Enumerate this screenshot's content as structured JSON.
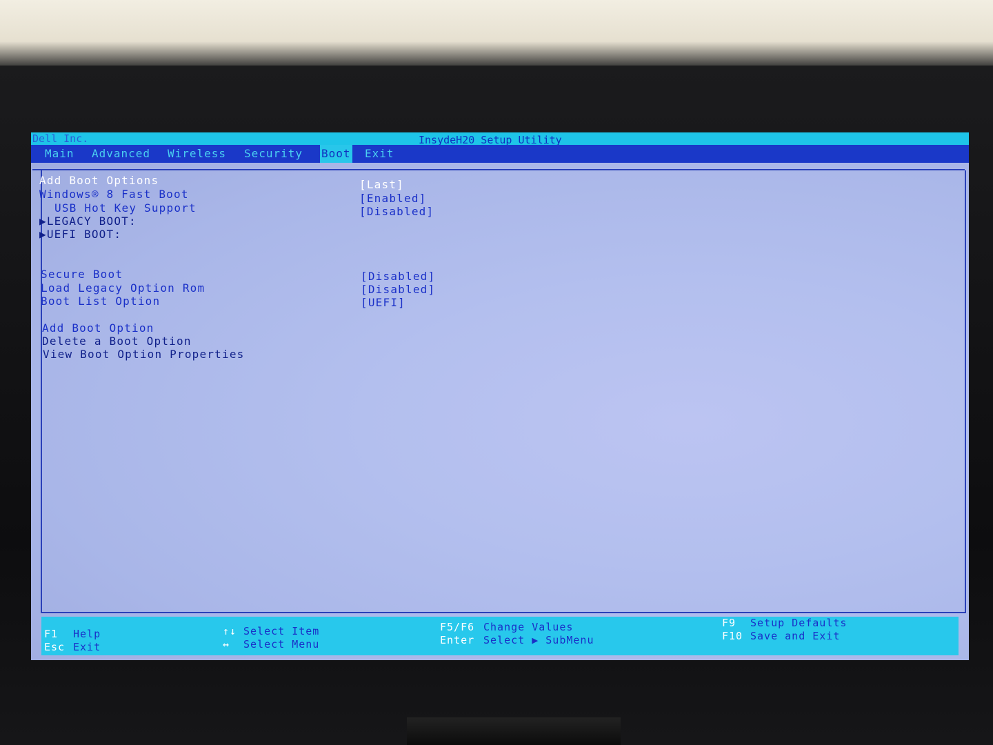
{
  "titlebar": {
    "vendor": "Dell Inc.",
    "utility": "InsydeH20 Setup Utility"
  },
  "menu": {
    "tabs": [
      "Main",
      "Advanced",
      "Wireless",
      "Security",
      "Boot",
      "Exit"
    ],
    "active": "Boot"
  },
  "boot": {
    "add_boot_options": {
      "label": "Add Boot Options",
      "value": "[Last]"
    },
    "fast_boot": {
      "label": "Windows® 8 Fast Boot",
      "value": "[Enabled]"
    },
    "usb_hotkey": {
      "label": "USB Hot Key Support",
      "value": "[Disabled]"
    },
    "legacy_boot": "▶LEGACY BOOT:",
    "uefi_boot": "▶UEFI BOOT:",
    "secure_boot": {
      "label": "Secure Boot",
      "value": "[Disabled]"
    },
    "legacy_rom": {
      "label": "Load Legacy Option Rom",
      "value": "[Disabled]"
    },
    "boot_list": {
      "label": "Boot List Option",
      "value": "[UEFI]"
    },
    "add_option": "Add Boot Option",
    "delete_option": "Delete a Boot Option",
    "view_option": "View Boot Option Properties"
  },
  "footer": {
    "f1_key": "F1",
    "f1_desc": "Help",
    "esc_key": "Esc",
    "esc_desc": "Exit",
    "updown_key": "↑↓",
    "updown_desc": "Select Item",
    "leftright_key": "↔",
    "leftright_desc": "Select Menu",
    "f5f6_key": "F5/F6",
    "f5f6_desc": "Change Values",
    "enter_key": "Enter",
    "enter_desc": "Select ▶ SubMenu",
    "f9_key": "F9",
    "f9_desc": "Setup Defaults",
    "f10_key": "F10",
    "f10_desc": "Save and Exit"
  }
}
